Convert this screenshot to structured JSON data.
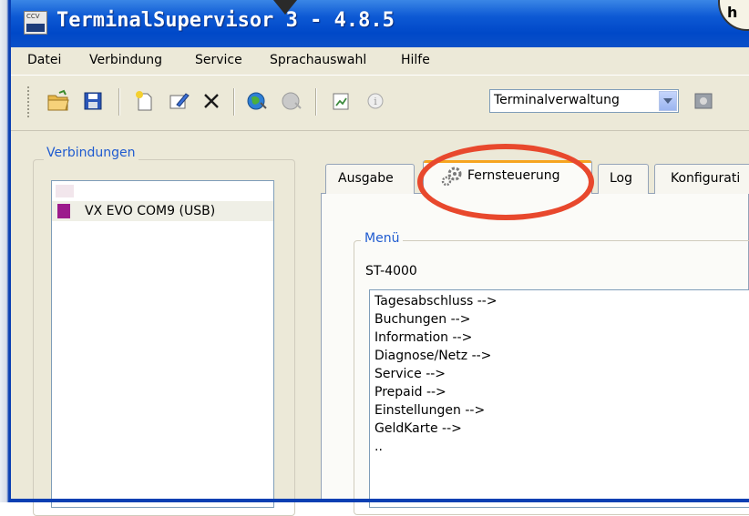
{
  "window": {
    "title": "TerminalSupervisor 3 - 4.8.5",
    "icon_name": "terminal-app-icon",
    "icon_text": "CCV",
    "corner_badge": "h"
  },
  "menubar": {
    "items": [
      "Datei",
      "Verbindung",
      "Service",
      "Sprachauswahl",
      "Hilfe"
    ]
  },
  "toolbar": {
    "buttons": [
      "open-folder-icon",
      "save-icon",
      "new-icon",
      "edit-icon",
      "delete-icon",
      "connect-globe-icon",
      "disconnect-globe-icon",
      "report-icon",
      "info-icon",
      "tool-icon"
    ],
    "combo_value": "Terminalverwaltung"
  },
  "connections": {
    "group_label": "Verbindungen",
    "items": [
      {
        "label": "VX EVO COM9 (USB)",
        "color": "#9c1b8c"
      }
    ]
  },
  "tabs": {
    "items": [
      "Ausgabe",
      "Fernsteuerung",
      "Log",
      "Konfigurati"
    ],
    "active": "Fernsteuerung"
  },
  "remote": {
    "group_label": "Menü",
    "terminal": "ST-4000",
    "entries": [
      "Tagesabschluss -->",
      "Buchungen -->",
      "Information -->",
      "Diagnose/Netz -->",
      "Service -->",
      "Prepaid -->",
      "Einstellungen -->",
      "GeldKarte -->",
      ".."
    ]
  },
  "colors": {
    "titlebar": "#0048c8",
    "highlight": "#e8482d",
    "tab_accent": "#f6a41f"
  }
}
